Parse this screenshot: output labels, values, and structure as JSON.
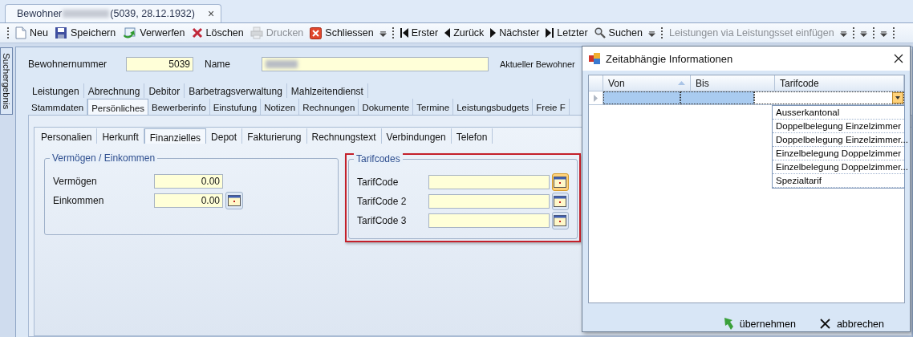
{
  "document_tab": {
    "title_prefix": "Bewohner",
    "title_suffix": "(5039, 28.12.1932)",
    "close": "×"
  },
  "toolbar": {
    "items": [
      {
        "kind": "grip"
      },
      {
        "kind": "button",
        "label": "Neu",
        "disabled": false
      },
      {
        "kind": "button",
        "label": "Speichern",
        "disabled": false
      },
      {
        "kind": "button",
        "label": "Verwerfen",
        "disabled": false
      },
      {
        "kind": "button",
        "label": "Löschen",
        "disabled": false
      },
      {
        "kind": "button",
        "label": "Drucken",
        "disabled": true
      },
      {
        "kind": "button",
        "label": "Schliessen",
        "disabled": false
      },
      {
        "kind": "overflow"
      },
      {
        "kind": "grip"
      },
      {
        "kind": "button",
        "label": "Erster",
        "disabled": false
      },
      {
        "kind": "button",
        "label": "Zurück",
        "disabled": false
      },
      {
        "kind": "button",
        "label": "Nächster",
        "disabled": false
      },
      {
        "kind": "button",
        "label": "Letzter",
        "disabled": false
      },
      {
        "kind": "button",
        "label": "Suchen",
        "disabled": false
      },
      {
        "kind": "overflow"
      },
      {
        "kind": "grip"
      },
      {
        "kind": "button",
        "label": "Leistungen via Leistungsset einfügen",
        "disabled": true
      },
      {
        "kind": "overflow"
      },
      {
        "kind": "grip"
      },
      {
        "kind": "overflow"
      },
      {
        "kind": "grip"
      },
      {
        "kind": "overflow"
      },
      {
        "kind": "grip"
      }
    ]
  },
  "side_panel": {
    "label": "Suchergebnis"
  },
  "header": {
    "number_label": "Bewohnernummer",
    "number_value": "5039",
    "name_label": "Name",
    "current_label": "Aktueller Bewohner"
  },
  "tabs_row_1": [
    {
      "label": "Leistungen",
      "selected": false
    },
    {
      "label": "Abrechnung",
      "selected": false
    },
    {
      "label": "Debitor",
      "selected": false
    },
    {
      "label": "Barbetragsverwaltung",
      "selected": false
    },
    {
      "label": "Mahlzeitendienst",
      "selected": false
    }
  ],
  "tabs_row_2": [
    {
      "label": "Stammdaten",
      "selected": false
    },
    {
      "label": "Persönliches",
      "selected": true
    },
    {
      "label": "Bewerberinfo",
      "selected": false
    },
    {
      "label": "Einstufung",
      "selected": false
    },
    {
      "label": "Notizen",
      "selected": false
    },
    {
      "label": "Rechnungen",
      "selected": false
    },
    {
      "label": "Dokumente",
      "selected": false
    },
    {
      "label": "Termine",
      "selected": false
    },
    {
      "label": "Leistungsbudgets",
      "selected": false
    },
    {
      "label": "Freie F",
      "selected": false
    }
  ],
  "sub_tabs": [
    {
      "label": "Personalien",
      "selected": false
    },
    {
      "label": "Herkunft",
      "selected": false
    },
    {
      "label": "Finanzielles",
      "selected": true
    },
    {
      "label": "Depot",
      "selected": false
    },
    {
      "label": "Fakturierung",
      "selected": false
    },
    {
      "label": "Rechnungstext",
      "selected": false
    },
    {
      "label": "Verbindungen",
      "selected": false
    },
    {
      "label": "Telefon",
      "selected": false
    }
  ],
  "groups": [
    {
      "title": "Vermögen / Einkommen",
      "highlighted": false,
      "fields": [
        {
          "label": "Vermögen",
          "value": "0.00",
          "picker": false
        },
        {
          "label": "Einkommen",
          "value": "0.00",
          "picker": true,
          "picker_hot": false
        }
      ]
    },
    {
      "title": "Tarifcodes",
      "highlighted": true,
      "fields": [
        {
          "label": "TarifCode",
          "picker": true,
          "picker_hot": true
        },
        {
          "label": "TarifCode 2",
          "picker": true,
          "picker_hot": false
        },
        {
          "label": "TarifCode 3",
          "picker": true,
          "picker_hot": false
        }
      ]
    }
  ],
  "dialog": {
    "title": "Zeitabhängie Informationen",
    "columns": [
      {
        "label": "Von",
        "sorted": true
      },
      {
        "label": "Bis",
        "sorted": false
      },
      {
        "label": "Tarifcode",
        "sorted": false
      }
    ],
    "row": {
      "selected": true
    },
    "dropdown_options": [
      "Ausserkantonal",
      "Doppelbelegung Einzelzimmer",
      "Doppelbelegung Einzelzimmer...",
      "Einzelbelegung Doppelzimmer",
      "Einzelbelegung Doppelzimmer...",
      "Spezialtarif"
    ],
    "buttons": [
      {
        "kind": "accept",
        "label": "übernehmen"
      },
      {
        "kind": "cancel",
        "label": "abbrechen"
      }
    ]
  }
}
